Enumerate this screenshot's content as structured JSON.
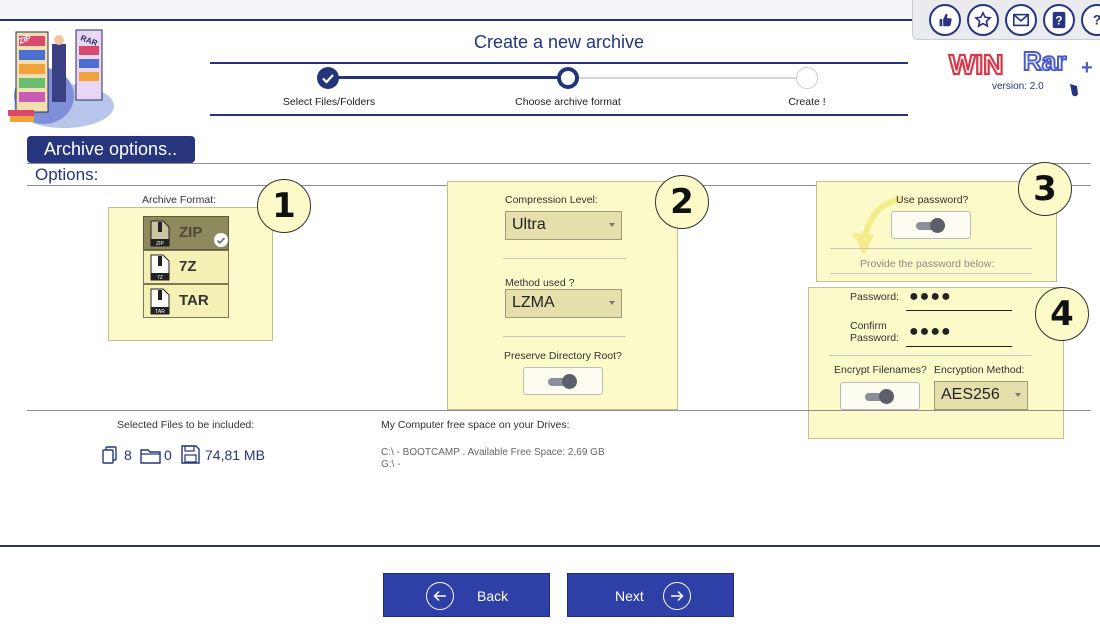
{
  "header": {
    "title": "Create a new archive"
  },
  "toolbar": {
    "icons": [
      "thumbs-up-icon",
      "star-icon",
      "mail-icon",
      "help-icon",
      "help-icon"
    ]
  },
  "logo": {
    "text": "WinRAR+",
    "version": "version: 2.0"
  },
  "steps": [
    {
      "label": "Select Files/Folders",
      "state": "done"
    },
    {
      "label": "Choose archive format",
      "state": "current"
    },
    {
      "label": "Create !",
      "state": "pending"
    }
  ],
  "section": {
    "button_label": "Archive options..",
    "options_label": "Options:"
  },
  "callouts": [
    "1",
    "2",
    "3",
    "4"
  ],
  "format": {
    "label": "Archive Format:",
    "items": [
      {
        "name": "ZIP",
        "icon_text": "ZIP",
        "selected": true
      },
      {
        "name": "7Z",
        "icon_text": "7Z",
        "selected": false
      },
      {
        "name": "TAR",
        "icon_text": "TAR",
        "selected": false
      }
    ]
  },
  "compression": {
    "level_label": "Compression Level:",
    "level_value": "Ultra",
    "method_label": "Method used ?",
    "method_value": "LZMA",
    "preserve_label": "Preserve Directory Root?",
    "preserve_on": true
  },
  "password": {
    "use_label": "Use password?",
    "use_on": true,
    "hint": "Provide the password below:",
    "password_label": "Password:",
    "password_value": "●●●●",
    "confirm_label_1": "Confirm",
    "confirm_label_2": "Password:",
    "confirm_value": "●●●●",
    "encrypt_names_label": "Encrypt Filenames?",
    "encrypt_names_on": true,
    "encryption_label": "Encryption Method:",
    "encryption_value": "AES256"
  },
  "summary": {
    "selected_label": "Selected Files to be included:",
    "files_count": "8",
    "folders_count": "0",
    "total_size": "74,81 MB",
    "drives_label": "My Computer free space on your Drives:",
    "drives": [
      "C:\\ - BOOTCAMP . Available Free Space: 2,69 GB",
      "G:\\ -"
    ]
  },
  "nav": {
    "back_label": "Back",
    "next_label": "Next"
  },
  "colors": {
    "accent": "#26357e",
    "panel": "#fbfac8",
    "button": "#2e3fa8"
  }
}
